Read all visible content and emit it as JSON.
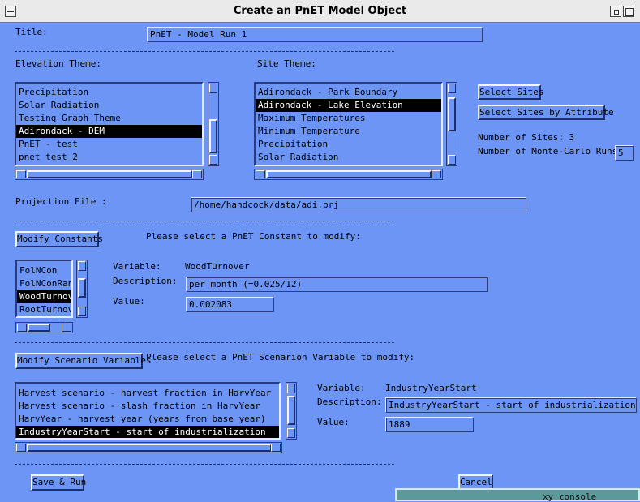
{
  "window": {
    "title": "Create an PnET Model Object"
  },
  "title_field": {
    "label": "Title:",
    "value": "PnET - Model Run 1"
  },
  "elevation": {
    "label": "Elevation Theme:",
    "items": [
      "Precipitation",
      "Solar Radiation",
      "Testing Graph Theme",
      "Adirondack - DEM",
      "PnET - test",
      "pnet test 2"
    ],
    "selected_index": 3
  },
  "site": {
    "label": "Site Theme:",
    "items": [
      "Adirondack - Park Boundary",
      "Adirondack - Lake Elevation",
      "Maximum Temperatures",
      "Minimum Temperature",
      "Precipitation",
      "Solar Radiation"
    ],
    "selected_index": 1
  },
  "buttons": {
    "select_sites": "Select Sites",
    "select_sites_attr": "Select Sites by Attribute",
    "modify_constants": "Modify Constants",
    "modify_scenario": "Modify Scenario Variables",
    "save_run": "Save & Run",
    "cancel": "Cancel"
  },
  "sites_info": {
    "num_sites_label": "Number of Sites: 3",
    "mc_runs_label": "Number of Monte-Carlo Runs:",
    "mc_runs_value": "5"
  },
  "projection": {
    "label": "Projection File :",
    "value": "/home/handcock/data/adi.prj"
  },
  "constants": {
    "prompt": "Please select a PnET Constant to modify:",
    "items": [
      "FolNCon",
      "FolNConRange",
      "WoodTurnover",
      "RootTurnover"
    ],
    "selected_index": 2,
    "variable_label": "Variable:",
    "variable_value": "WoodTurnover",
    "description_label": "Description:",
    "description_value": "per month (=0.025/12)",
    "value_label": "Value:",
    "value_value": "0.002083"
  },
  "scenario": {
    "prompt": "Please select a PnET Scenarion Variable to modify:",
    "items": [
      "Harvest scenario - harvest fraction in HarvYear",
      "Harvest scenario - slash fraction in HarvYear",
      "HarvYear - harvest year (years from base year)",
      "IndustryYearStart - start of industrialization"
    ],
    "selected_index": 3,
    "variable_label": "Variable:",
    "variable_value": "IndustryYearStart",
    "description_label": "Description:",
    "description_value": "IndustryYearStart - start of industrialization",
    "value_label": "Value:",
    "value_value": "1889"
  },
  "console": {
    "label": "xy console"
  },
  "colors": {
    "background": "#6c95f6",
    "selection": "#000000",
    "titlebar": "#eaeaea",
    "console": "#5a9a9a"
  }
}
